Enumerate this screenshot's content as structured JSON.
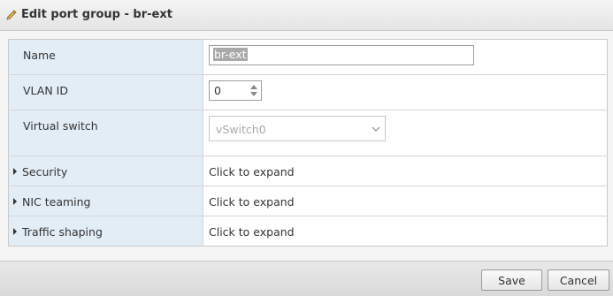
{
  "dialog": {
    "title": "Edit port group - br-ext",
    "title_icon": "pencil-icon"
  },
  "fields": {
    "name": {
      "label": "Name",
      "value": "br-ext"
    },
    "vlan": {
      "label": "VLAN ID",
      "value": "0"
    },
    "vswitch": {
      "label": "Virtual switch",
      "value": "vSwitch0"
    }
  },
  "sections": [
    {
      "label": "Security",
      "value": "Click to expand"
    },
    {
      "label": "NIC teaming",
      "value": "Click to expand"
    },
    {
      "label": "Traffic shaping",
      "value": "Click to expand"
    }
  ],
  "footer": {
    "save_label": "Save",
    "cancel_label": "Cancel"
  },
  "colors": {
    "label_bg": "#e2edf6",
    "selection": "#a9a9a9"
  }
}
